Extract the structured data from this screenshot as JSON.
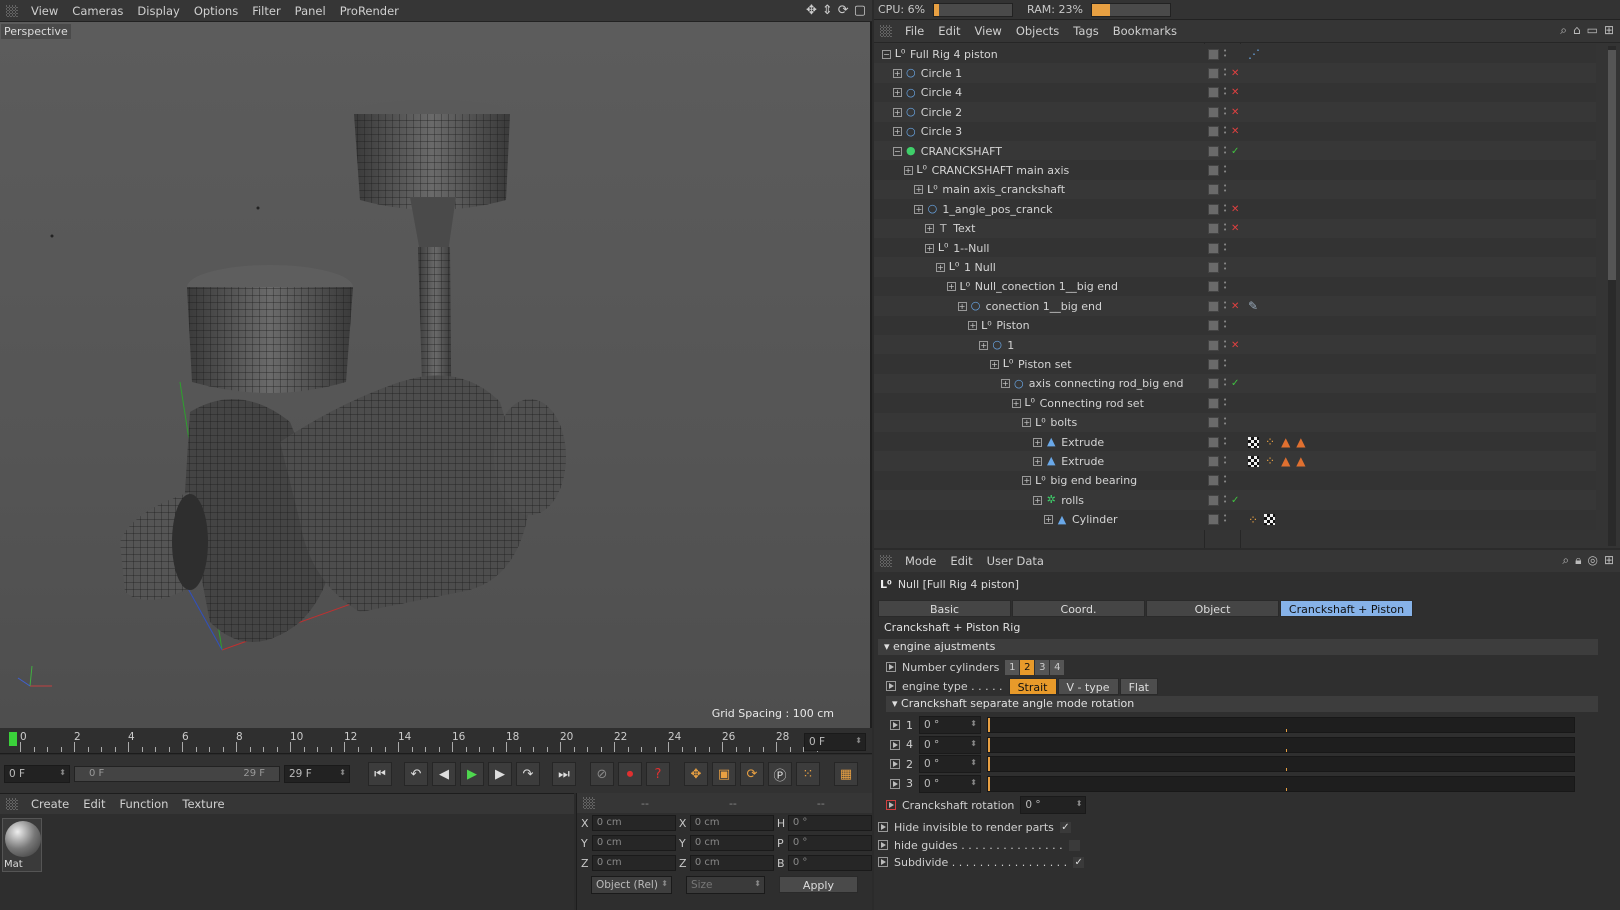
{
  "menubar": {
    "items": [
      "View",
      "Cameras",
      "Display",
      "Options",
      "Filter",
      "Panel",
      "ProRender"
    ]
  },
  "viewport": {
    "label": "Perspective",
    "grid_spacing": "Grid Spacing : 100 cm"
  },
  "timeline": {
    "ticks": [
      "0",
      "2",
      "4",
      "6",
      "8",
      "10",
      "12",
      "14",
      "16",
      "18",
      "20",
      "22",
      "24",
      "26",
      "28"
    ],
    "frame_field": "0 F"
  },
  "playbar": {
    "start": "0 F",
    "range_start": "0 F",
    "range_end": "29 F",
    "end": "29 F"
  },
  "materials": {
    "menu": [
      "Create",
      "Edit",
      "Function",
      "Texture"
    ],
    "mat_name": "Mat"
  },
  "coords": {
    "headers": [
      "--",
      "--",
      "--"
    ],
    "rows": [
      {
        "a": "X",
        "av": "0 cm",
        "b": "X",
        "bv": "0 cm",
        "c": "H",
        "cv": "0 °"
      },
      {
        "a": "Y",
        "av": "0 cm",
        "b": "Y",
        "bv": "0 cm",
        "c": "P",
        "cv": "0 °"
      },
      {
        "a": "Z",
        "av": "0 cm",
        "b": "Z",
        "bv": "0 cm",
        "c": "B",
        "cv": "0 °"
      }
    ],
    "mode": "Object (Rel)",
    "size": "Size",
    "apply": "Apply"
  },
  "sysinfo": {
    "cpu": "CPU: 6%",
    "cpu_pct": 6,
    "ram": "RAM: 23%",
    "ram_pct": 23,
    "accent": "#e8a042"
  },
  "objects": {
    "menu": [
      "File",
      "Edit",
      "View",
      "Objects",
      "Tags",
      "Bookmarks"
    ],
    "rows": [
      {
        "name": "Full Rig 4 piston",
        "icon": "null",
        "tag": "xpresso"
      },
      {
        "name": "Circle 1",
        "icon": "circle",
        "check": "x"
      },
      {
        "name": "Circle 4",
        "icon": "circle",
        "check": "x"
      },
      {
        "name": "Circle 2",
        "icon": "circle",
        "check": "x"
      },
      {
        "name": "Circle 3",
        "icon": "circle",
        "check": "x"
      },
      {
        "name": "CRANCKSHAFT",
        "icon": "green",
        "check": "v"
      },
      {
        "name": "CRANCKSHAFT main axis",
        "icon": "null"
      },
      {
        "name": "main axis_cranckshaft",
        "icon": "null"
      },
      {
        "name": "1_angle_pos_cranck",
        "icon": "circle",
        "check": "x"
      },
      {
        "name": "Text",
        "icon": "text",
        "check": "x"
      },
      {
        "name": "1--Null",
        "icon": "null"
      },
      {
        "name": "1 Null",
        "icon": "null"
      },
      {
        "name": "Null_conection 1__big end",
        "icon": "null"
      },
      {
        "name": "conection 1__big end",
        "icon": "circle",
        "check": "x",
        "tag": "constraint"
      },
      {
        "name": "Piston",
        "icon": "null"
      },
      {
        "name": "1",
        "icon": "circle",
        "check": "x"
      },
      {
        "name": "Piston set",
        "icon": "null"
      },
      {
        "name": "axis connecting rod_big end",
        "icon": "circle",
        "check": "v"
      },
      {
        "name": "Connecting rod set",
        "icon": "null"
      },
      {
        "name": "bolts",
        "icon": "null"
      },
      {
        "name": "Extrude",
        "icon": "extrude",
        "tag": "mats"
      },
      {
        "name": "Extrude",
        "icon": "extrude",
        "tag": "mats"
      },
      {
        "name": "big end bearing",
        "icon": "null"
      },
      {
        "name": "rolls",
        "icon": "cloner",
        "check": "v"
      },
      {
        "name": "Cylinder",
        "icon": "extrude",
        "tag": "mats2"
      }
    ]
  },
  "attributes": {
    "menu": [
      "Mode",
      "Edit",
      "User Data"
    ],
    "object_title": "Null [Full Rig 4 piston]",
    "tabs": [
      "Basic",
      "Coord.",
      "Object",
      "Cranckshaft + Piston Rig"
    ],
    "group_title": "Cranckshaft + Piston Rig",
    "section1": "engine ajustments",
    "num_cyl_label": "Number cylinders",
    "num_cyl_options": [
      "1",
      "2",
      "3",
      "4"
    ],
    "num_cyl_selected": "2",
    "engine_type_label": "engine type . . . . .",
    "engine_types": [
      "Strait",
      "V - type",
      "Flat"
    ],
    "engine_selected": "Strait",
    "section2": "Cranckshaft separate angle mode rotation",
    "angles": [
      {
        "n": "1",
        "v": "0 °"
      },
      {
        "n": "4",
        "v": "0 °"
      },
      {
        "n": "2",
        "v": "0 °"
      },
      {
        "n": "3",
        "v": "0 °"
      }
    ],
    "rotation_label": "Cranckshaft rotation",
    "rotation_value": "0 °",
    "hide_invisible": "Hide invisible to render parts",
    "hide_guides": "hide guides . . . . . . . . . . . . . . .",
    "subdivide": "Subdivide . . . . . . . . . . . . . . . . ."
  }
}
